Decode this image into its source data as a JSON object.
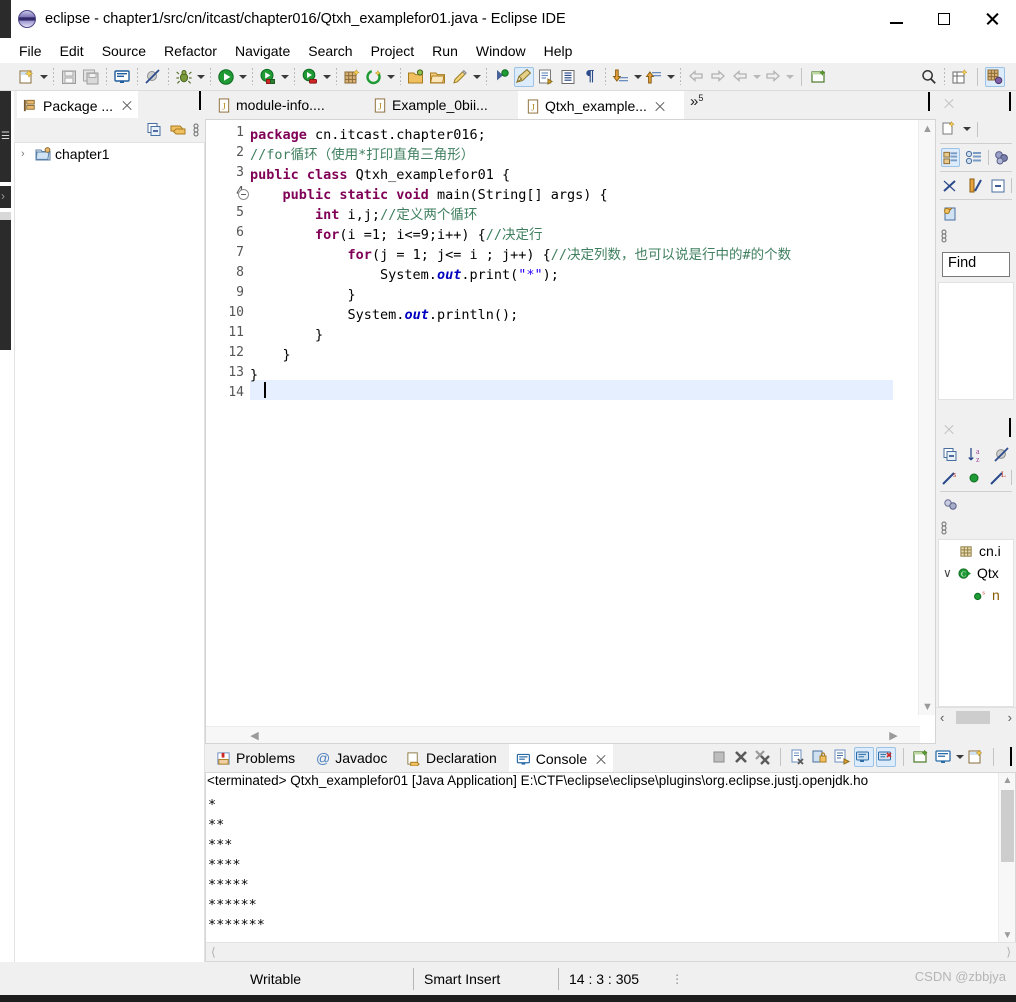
{
  "window": {
    "title": "eclipse - chapter1/src/cn/itcast/chapter016/Qtxh_examplefor01.java - Eclipse IDE",
    "app_icon": "eclipse-logo-icon",
    "minimize": "–",
    "maximize": "□",
    "close": "✕"
  },
  "menubar": {
    "items": [
      {
        "label": "File"
      },
      {
        "label": "Edit"
      },
      {
        "label": "Source"
      },
      {
        "label": "Refactor"
      },
      {
        "label": "Navigate"
      },
      {
        "label": "Search"
      },
      {
        "label": "Project"
      },
      {
        "label": "Run"
      },
      {
        "label": "Window"
      },
      {
        "label": "Help"
      }
    ]
  },
  "toolbar": {
    "icons": [
      "new-wizard-icon",
      "save-icon",
      "save-all-icon",
      "new-java-console-icon",
      "skip-breakpoints-icon",
      "debug-icon",
      "run-icon",
      "run-last-tool-icon",
      "external-tools-icon",
      "new-package-icon",
      "open-type-icon",
      "open-task-icon",
      "open-resource-icon",
      "pencil-annotate-icon",
      "previous-annotation-icon",
      "next-annotation-icon",
      "toggle-mark-occurrences-icon",
      "link-with-editor-icon",
      "show-whitespace-icon",
      "pilcrow-icon",
      "next-edit-icon",
      "previous-edit-icon",
      "back-icon",
      "forward-icon",
      "back-history-icon",
      "forward-history-icon",
      "new-window-icon",
      "search-icon",
      "open-perspective-icon",
      "java-perspective-icon"
    ]
  },
  "package_explorer": {
    "tab_label": "Package ...",
    "tab_icon": "package-explorer-icon",
    "toolbar_icons": [
      "collapse-all-icon",
      "link-with-editor-icon",
      "view-menu-icon"
    ],
    "tree": [
      {
        "arrow": "›",
        "icon": "java-project-icon",
        "label": "chapter1"
      }
    ]
  },
  "editor": {
    "tabs": [
      {
        "label": "module-info....",
        "icon": "java-file-icon",
        "active": false,
        "closable": false
      },
      {
        "label": "Example_0bii...",
        "icon": "java-file-icon",
        "active": false,
        "closable": false
      },
      {
        "label": "Qtxh_example...",
        "icon": "java-file-icon",
        "active": true,
        "closable": true
      }
    ],
    "overflow_label": "»",
    "overflow_count": "5",
    "lines": [
      {
        "n": "1",
        "fold": false,
        "tokens": [
          {
            "t": "package ",
            "c": "k"
          },
          {
            "t": "cn.itcast.chapter016;",
            "c": "pl"
          }
        ]
      },
      {
        "n": "2",
        "fold": false,
        "tokens": [
          {
            "t": "//for循环（使用*打印直角三角形）",
            "c": "cm"
          }
        ]
      },
      {
        "n": "3",
        "fold": false,
        "tokens": [
          {
            "t": "public class ",
            "c": "k"
          },
          {
            "t": "Qtxh_examplefor01 {",
            "c": "pl"
          }
        ]
      },
      {
        "n": "4",
        "fold": true,
        "tokens": [
          {
            "t": "    ",
            "c": "pl"
          },
          {
            "t": "public static void ",
            "c": "k"
          },
          {
            "t": "main(String[] args) {",
            "c": "pl"
          }
        ]
      },
      {
        "n": "5",
        "fold": false,
        "tokens": [
          {
            "t": "        ",
            "c": "pl"
          },
          {
            "t": "int ",
            "c": "k"
          },
          {
            "t": "i,j;",
            "c": "pl"
          },
          {
            "t": "//定义两个循环",
            "c": "cm"
          }
        ]
      },
      {
        "n": "6",
        "fold": false,
        "tokens": [
          {
            "t": "        ",
            "c": "pl"
          },
          {
            "t": "for",
            "c": "k"
          },
          {
            "t": "(i =1; i<=9;i++) {",
            "c": "pl"
          },
          {
            "t": "//决定行",
            "c": "cm"
          }
        ]
      },
      {
        "n": "7",
        "fold": false,
        "tokens": [
          {
            "t": "            ",
            "c": "pl"
          },
          {
            "t": "for",
            "c": "k"
          },
          {
            "t": "(j = 1; j<= i ; j++) {",
            "c": "pl"
          },
          {
            "t": "//决定列数，也可以说是行中的#的个数",
            "c": "cm"
          }
        ]
      },
      {
        "n": "8",
        "fold": false,
        "tokens": [
          {
            "t": "                System.",
            "c": "pl"
          },
          {
            "t": "out",
            "c": "fld"
          },
          {
            "t": ".print(",
            "c": "pl"
          },
          {
            "t": "\"*\"",
            "c": "st"
          },
          {
            "t": ");",
            "c": "pl"
          }
        ]
      },
      {
        "n": "9",
        "fold": false,
        "tokens": [
          {
            "t": "            }",
            "c": "pl"
          }
        ]
      },
      {
        "n": "10",
        "fold": false,
        "tokens": [
          {
            "t": "            System.",
            "c": "pl"
          },
          {
            "t": "out",
            "c": "fld"
          },
          {
            "t": ".println();",
            "c": "pl"
          }
        ]
      },
      {
        "n": "11",
        "fold": false,
        "tokens": [
          {
            "t": "        }",
            "c": "pl"
          }
        ]
      },
      {
        "n": "12",
        "fold": false,
        "tokens": [
          {
            "t": "    }",
            "c": "pl"
          }
        ]
      },
      {
        "n": "13",
        "fold": false,
        "tokens": [
          {
            "t": "}",
            "c": "pl"
          }
        ]
      },
      {
        "n": "14",
        "fold": false,
        "tokens": []
      }
    ]
  },
  "right_panels": {
    "top": {
      "toolbar_icons": [
        "new-search-icon",
        "search-dropdown-icon"
      ],
      "row2_icons": [
        "show-as-tree-icon",
        "show-as-list-icon",
        "group-by-icon"
      ],
      "row3_icons": [
        "remove-selected-match-icon",
        "remove-all-matches-icon",
        "collapse-all-icon"
      ],
      "row4_icons": [
        "search-history-icon"
      ],
      "menu_icon": "view-menu-icon",
      "find_value": "Find"
    },
    "bottom": {
      "toolbar_icons": [
        "collapse-all-icon",
        "sort-alpha-icon",
        "hide-fields-icon"
      ],
      "row2_icons": [
        "hide-static-icon",
        "hide-non-public-icon",
        "hide-local-types-icon"
      ],
      "row3_icons": [
        "focus-icon"
      ],
      "menu_icon": "view-menu-icon",
      "tree": [
        {
          "indent": 1,
          "arrow": "",
          "icon": "package-icon",
          "label": "cn.i"
        },
        {
          "indent": 0,
          "arrow": "∨",
          "icon": "class-icon",
          "label": "Qtx"
        },
        {
          "indent": 2,
          "arrow": "",
          "icon": "method-static-icon",
          "label": "n"
        }
      ],
      "scroll_left": "‹",
      "scroll_right": "›"
    }
  },
  "console": {
    "tabs": [
      {
        "label": "Problems",
        "icon": "problems-icon",
        "active": false,
        "closable": false
      },
      {
        "label": "Javadoc",
        "icon": "javadoc-icon",
        "active": false,
        "closable": false
      },
      {
        "label": "Declaration",
        "icon": "declaration-icon",
        "active": false,
        "closable": false
      },
      {
        "label": "Console",
        "icon": "console-icon",
        "active": true,
        "closable": true
      }
    ],
    "toolbar_icons": [
      "terminate-icon",
      "remove-launch-icon",
      "remove-all-launches-icon",
      "clear-console-icon",
      "lock-scroll-icon",
      "show-console-on-output-icon",
      "pin-console-icon",
      "display-selected-console-icon",
      "new-console-view-icon",
      "open-console-icon",
      "open-console-dropdown-icon",
      "new-editor-icon"
    ],
    "header": "<terminated> Qtxh_examplefor01 [Java Application] E:\\CTF\\eclipse\\eclipse\\plugins\\org.eclipse.justj.openjdk.ho",
    "output": "*\n**\n***\n****\n*****\n******\n*******"
  },
  "statusbar": {
    "writable": "Writable",
    "insert_mode": "Smart Insert",
    "position": "14 : 3 : 305",
    "dots": "⋮"
  },
  "watermark": "CSDN @zbbjya"
}
